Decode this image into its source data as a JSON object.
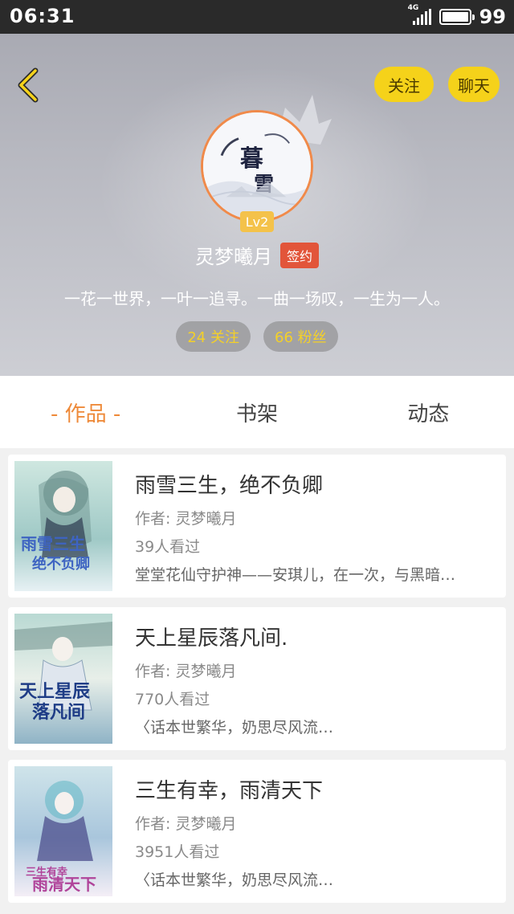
{
  "status_bar": {
    "time": "06:31",
    "network": "4G",
    "battery": "99"
  },
  "header": {
    "follow_button": "关注",
    "chat_button": "聊天",
    "avatar_text": "暮雪",
    "level": "Lv2",
    "username": "灵梦曦月",
    "badge": "签约",
    "motto": "一花一世界，一叶一追寻。一曲一场叹，一生为一人。",
    "following": "24 关注",
    "fans": "66 粉丝"
  },
  "tabs": [
    "- 作品 -",
    "书架",
    "动态"
  ],
  "books": [
    {
      "title": "雨雪三生，绝不负卿",
      "author": "作者: 灵梦曦月",
      "views": "39人看过",
      "desc": "堂堂花仙守护神——安琪儿，在一次，与黑暗…",
      "cover_text": "雨雪三生 绝不负卿"
    },
    {
      "title": "天上星辰落凡间.",
      "author": "作者: 灵梦曦月",
      "views": "770人看过",
      "desc": "〈话本世繁华，奶思尽风流…",
      "cover_text": "天上星辰 落凡间"
    },
    {
      "title": "三生有幸，雨清天下",
      "author": "作者: 灵梦曦月",
      "views": "3951人看过",
      "desc": "〈话本世繁华，奶思尽风流…",
      "cover_text": "三生有幸 雨清天下"
    }
  ],
  "colors": {
    "accent": "#ee8a3a",
    "button_yellow": "#f5d21a",
    "badge_red": "#e2553a"
  }
}
